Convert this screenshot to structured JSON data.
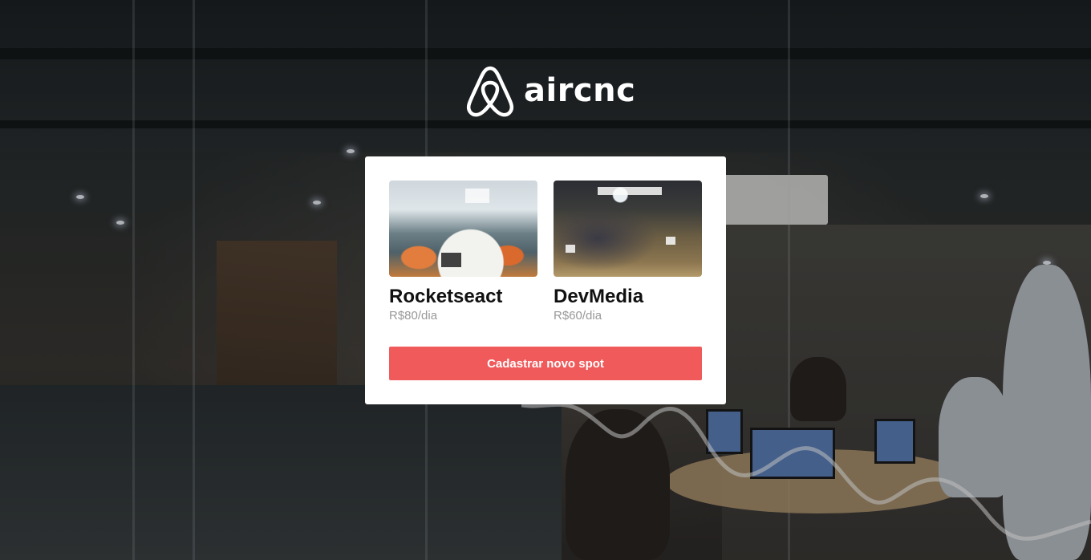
{
  "brand": {
    "logo_text": "aircnc",
    "logo_icon": "airbnb-belo-icon"
  },
  "spots": [
    {
      "name": "Rocketseact",
      "price": "R$80/dia"
    },
    {
      "name": "DevMedia",
      "price": "R$60/dia"
    }
  ],
  "actions": {
    "new_spot_label": "Cadastrar novo spot"
  },
  "colors": {
    "accent": "#f05a5b",
    "card": "#ffffff",
    "price_text": "#999999",
    "title_text": "#111111"
  }
}
